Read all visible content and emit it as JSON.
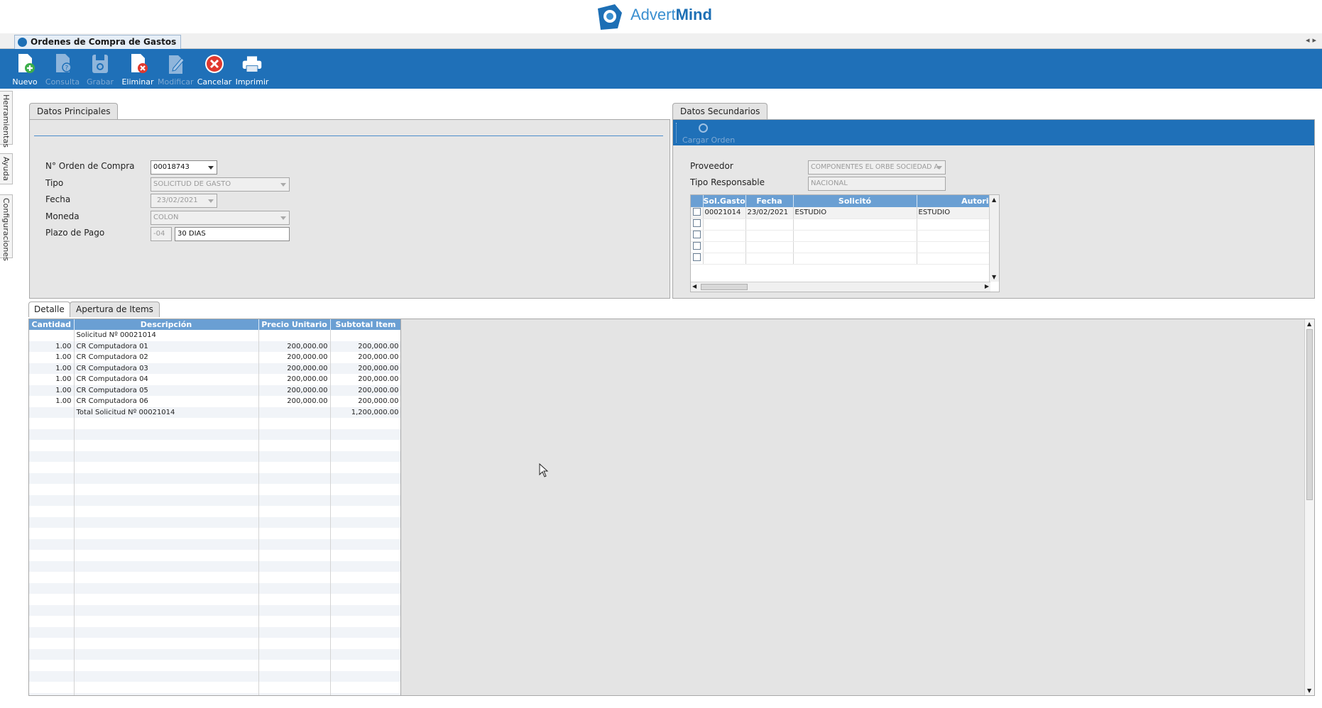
{
  "brand": {
    "name_light": "Advert",
    "name_bold": "Mind"
  },
  "window": {
    "tab_title": "Ordenes de Compra de Gastos"
  },
  "toolbar": {
    "buttons": [
      {
        "label": "Nuevo",
        "icon": "new-document-icon",
        "enabled": true
      },
      {
        "label": "Consulta",
        "icon": "query-document-icon",
        "enabled": false
      },
      {
        "label": "Grabar",
        "icon": "save-icon",
        "enabled": false
      },
      {
        "label": "Eliminar",
        "icon": "delete-document-icon",
        "enabled": true
      },
      {
        "label": "Modificar",
        "icon": "edit-icon",
        "enabled": false
      },
      {
        "label": "Cancelar",
        "icon": "cancel-icon",
        "enabled": true
      },
      {
        "label": "Imprimir",
        "icon": "printer-icon",
        "enabled": true
      }
    ]
  },
  "side_tabs": [
    "Herramientas",
    "Ayuda",
    "Configuraciones"
  ],
  "principal": {
    "tab_label": "Datos Principales",
    "orden_label": "N° Orden de Compra",
    "orden_value": "00018743",
    "tipo_label": "Tipo",
    "tipo_value": "SOLICITUD DE GASTO",
    "fecha_label": "Fecha",
    "fecha_value": "23/02/2021",
    "moneda_label": "Moneda",
    "moneda_value": "COLON",
    "plazo_label": "Plazo de Pago",
    "plazo_code": "-04",
    "plazo_value": "30 DIAS"
  },
  "secundarios": {
    "tab_label": "Datos Secundarios",
    "cargar_label": "Cargar Orden",
    "proveedor_label": "Proveedor",
    "proveedor_value": "COMPONENTES EL ORBE SOCIEDAD A",
    "tipo_resp_label": "Tipo Responsable",
    "tipo_resp_value": "NACIONAL",
    "grid_headers": [
      "Sol.Gasto",
      "Fecha",
      "Solicitó",
      "Autori"
    ],
    "grid_rows": [
      [
        "00021014",
        "23/02/2021",
        "ESTUDIO",
        "ESTUDIO"
      ]
    ]
  },
  "detail_tabs": [
    "Detalle",
    "Apertura de Items"
  ],
  "detail": {
    "headers": [
      "Cantidad",
      "Descripción",
      "Precio Unitario",
      "Subtotal Item"
    ],
    "rows": [
      [
        "",
        "Solicitud Nº 00021014",
        "",
        ""
      ],
      [
        "1.00",
        "CR  Computadora 01",
        "200,000.00",
        "200,000.00"
      ],
      [
        "1.00",
        "CR  Computadora 02",
        "200,000.00",
        "200,000.00"
      ],
      [
        "1.00",
        "CR  Computadora 03",
        "200,000.00",
        "200,000.00"
      ],
      [
        "1.00",
        "CR  Computadora 04",
        "200,000.00",
        "200,000.00"
      ],
      [
        "1.00",
        "CR  Computadora 05",
        "200,000.00",
        "200,000.00"
      ],
      [
        "1.00",
        "CR  Computadora 06",
        "200,000.00",
        "200,000.00"
      ],
      [
        "",
        "Total Solicitud Nº 00021014",
        "",
        "1,200,000.00"
      ]
    ]
  }
}
